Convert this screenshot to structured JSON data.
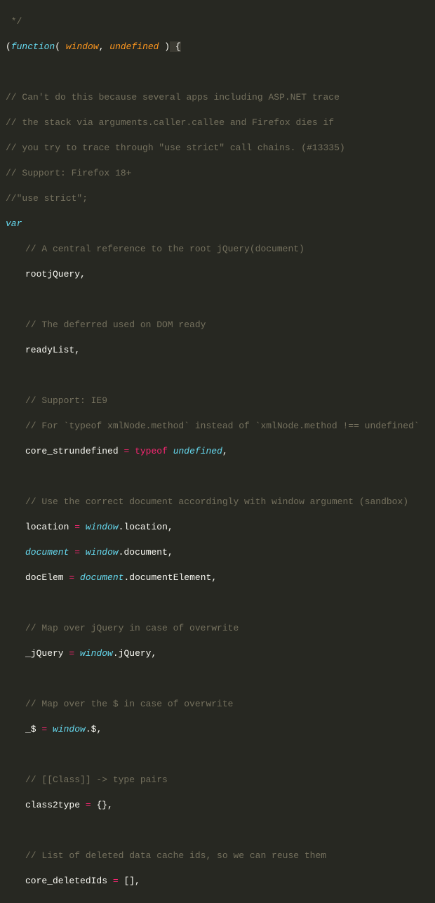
{
  "code": {
    "line01": " */",
    "line02a": "(",
    "line02b": "function",
    "line02c": "( ",
    "line02d": "window",
    "line02e": ", ",
    "line02f": "undefined",
    "line02g": " )",
    "line02h": " {",
    "blank": "",
    "line04": "// Can't do this because several apps including ASP.NET trace",
    "line05": "// the stack via arguments.caller.callee and Firefox dies if",
    "line06": "// you try to trace through \"use strict\" call chains. (#13335)",
    "line07": "// Support: Firefox 18+",
    "line08": "//\"use strict\";",
    "line09": "var",
    "line10": "// A central reference to the root jQuery(document)",
    "line11a": "rootjQuery",
    "line11b": ",",
    "line13": "// The deferred used on DOM ready",
    "line14a": "readyList",
    "line14b": ",",
    "line16": "// Support: IE9",
    "line17": "// For `typeof xmlNode.method` instead of `xmlNode.method !== undefined`",
    "line18a": "core_strundefined ",
    "line18b": "=",
    "line18c": " ",
    "line18d": "typeof",
    "line18e": " ",
    "line18f": "undefined",
    "line18g": ",",
    "line20": "// Use the correct document accordingly with window argument (sandbox)",
    "line21a": "location ",
    "line21b": "=",
    "line21c": " ",
    "line21d": "window",
    "line21e": ".",
    "line21f": "location",
    "line21g": ",",
    "line22a": "document",
    "line22b": " ",
    "line22c": "=",
    "line22d": " ",
    "line22e": "window",
    "line22f": ".",
    "line22g": "document",
    "line22h": ",",
    "line23a": "docElem ",
    "line23b": "=",
    "line23c": " ",
    "line23d": "document",
    "line23e": ".",
    "line23f": "documentElement",
    "line23g": ",",
    "line25": "// Map over jQuery in case of overwrite",
    "line26a": "_jQuery ",
    "line26b": "=",
    "line26c": " ",
    "line26d": "window",
    "line26e": ".",
    "line26f": "jQuery",
    "line26g": ",",
    "line28": "// Map over the $ in case of overwrite",
    "line29a": "_$ ",
    "line29b": "=",
    "line29c": " ",
    "line29d": "window",
    "line29e": ".",
    "line29f": "$",
    "line29g": ",",
    "line31": "// [[Class]] -> type pairs",
    "line32a": "class2type ",
    "line32b": "=",
    "line32c": " {},",
    "line34": "// List of deleted data cache ids, so we can reuse them",
    "line35a": "core_deletedIds ",
    "line35b": "=",
    "line35c": " [],"
  }
}
